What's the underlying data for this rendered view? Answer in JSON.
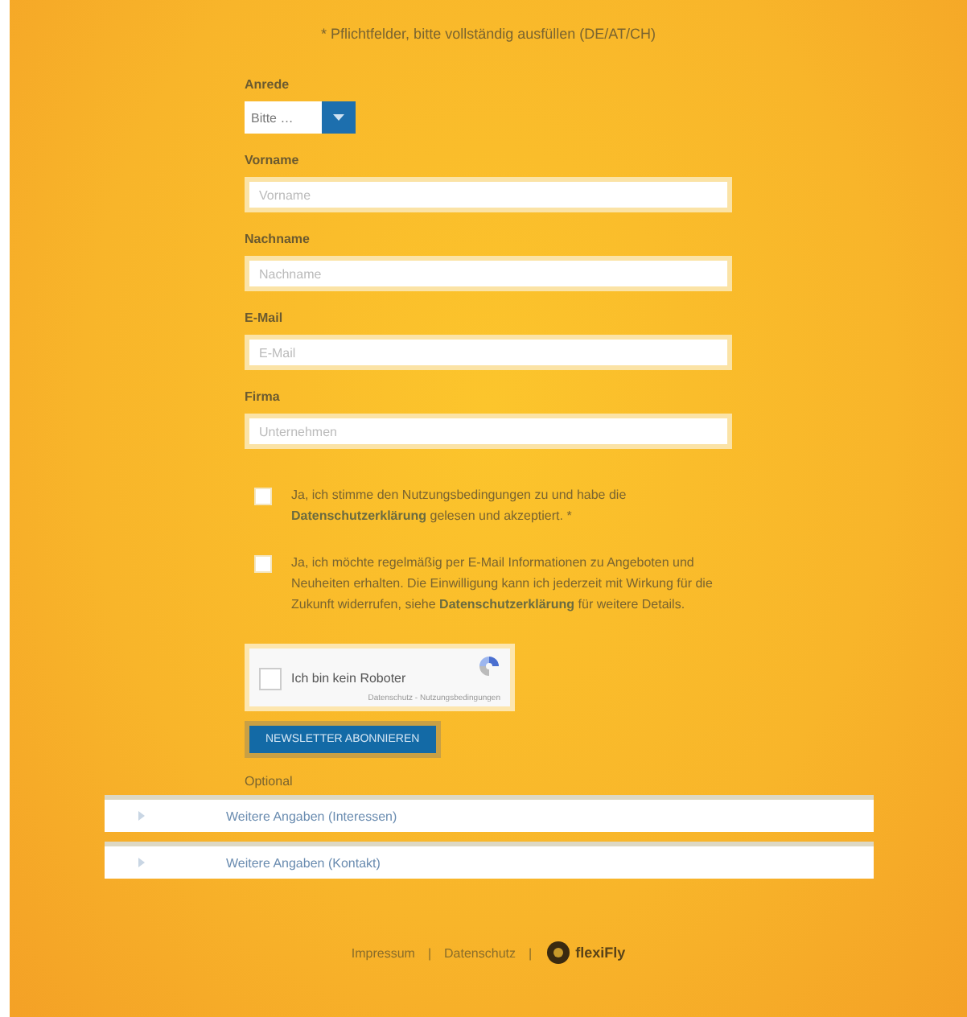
{
  "intro": "* Pflichtfelder, bitte vollständig ausfüllen (DE/AT/CH)",
  "salutation": {
    "label": "Anrede",
    "value": "Bitte …"
  },
  "fields": [
    {
      "label": "Vorname",
      "placeholder": "Vorname"
    },
    {
      "label": "Nachname",
      "placeholder": "Nachname"
    },
    {
      "label": "E-Mail",
      "placeholder": "E-Mail"
    },
    {
      "label": "Firma",
      "placeholder": "Unternehmen"
    }
  ],
  "consents": [
    {
      "checked": false,
      "text": "Ja, ich stimme den Nutzungsbedingungen zu und habe die **Datenschutzerklärung** gelesen und akzeptiert. *"
    },
    {
      "checked": false,
      "text": "Ja, ich möchte regelmäßig per E-Mail Informationen zu Angeboten und Neuheiten erhalten. Die Einwilligung kann ich jederzeit mit Wirkung für die Zukunft widerrufen, siehe **Datenschutzerklärung** für weitere Details."
    }
  ],
  "captcha": {
    "label": "Ich bin kein Roboter",
    "checked": false,
    "footer": "Datenschutz - Nutzungsbedingungen"
  },
  "submit": "NEWSLETTER ABONNIEREN",
  "section_title": "Optional",
  "accordion": [
    {
      "label": "Weitere Angaben (Interessen)",
      "expanded": false
    },
    {
      "label": "Weitere Angaben (Kontakt)",
      "expanded": false
    }
  ],
  "footer": {
    "links": [
      {
        "label": "Impressum",
        "separator": "|"
      },
      {
        "label": "Datenschutz",
        "separator": "|"
      }
    ],
    "brand": "flexiFly"
  }
}
